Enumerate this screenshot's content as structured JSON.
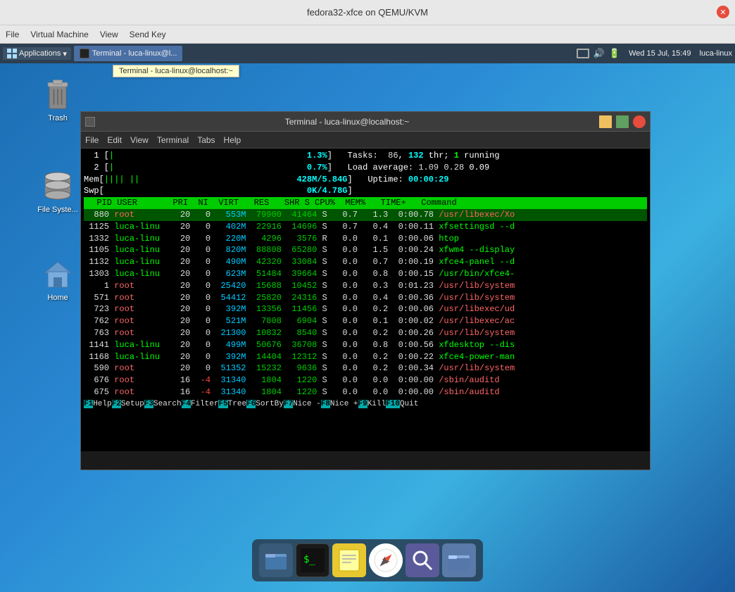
{
  "qemu": {
    "title": "fedora32-xfce on QEMU/KVM",
    "menu": {
      "file": "File",
      "virtual_machine": "Virtual Machine",
      "view": "View",
      "send_key": "Send Key"
    }
  },
  "xfce": {
    "applications": "Applications",
    "task_terminal": "Terminal - luca-linux@l...",
    "clock": "Wed 15 Jul, 15:49",
    "user": "luca-linux"
  },
  "tooltip": "Terminal - luca-linux@localhost:~",
  "desktop_icons": {
    "trash": "Trash",
    "filesystem": "File Syste...",
    "home": "Home"
  },
  "terminal": {
    "title": "Terminal - luca-linux@localhost:~",
    "menu": {
      "file": "File",
      "edit": "Edit",
      "view": "View",
      "terminal": "Terminal",
      "tabs": "Tabs",
      "help": "Help"
    }
  },
  "htop": {
    "cpu1_label": "1",
    "cpu1_bar": "[|  ",
    "cpu1_pct": "1.3%",
    "cpu2_label": "2",
    "cpu2_bar": "[| ",
    "cpu2_pct": "0.7%",
    "mem_label": "Mem",
    "mem_bar": "[|||| ||",
    "mem_val": "428M/5.84G",
    "swap_label": "Swp",
    "swap_bar": "[",
    "swap_val": "0K/4.78G",
    "tasks_label": "Tasks:",
    "tasks_count": "86",
    "tasks_thr": "132",
    "tasks_thr_label": "thr;",
    "tasks_running": "1",
    "tasks_running_label": "running",
    "load_label": "Load average:",
    "load1": "1.09",
    "load5": "0.28",
    "load15": "0.09",
    "uptime_label": "Uptime:",
    "uptime_val": "00:00:29",
    "columns": "  PID USER       PRI  NI  VIRT   RES   SHR S CPU%  MEM%   TIME+   Command",
    "processes": [
      {
        "pid": "880",
        "user": "root",
        "pri": "20",
        "ni": "0",
        "virt": "553M",
        "res": "79900",
        "shr": "41464",
        "s": "S",
        "cpu": "0.7",
        "mem": "1.3",
        "time": "0:00.78",
        "cmd": "/usr/libexec/Xo",
        "selected": true
      },
      {
        "pid": "1125",
        "user": "luca-linu",
        "pri": "20",
        "ni": "0",
        "virt": "402M",
        "res": "22916",
        "shr": "14696",
        "s": "S",
        "cpu": "0.7",
        "mem": "0.4",
        "time": "0:00.11",
        "cmd": "xfsettingsd --d",
        "selected": false
      },
      {
        "pid": "1332",
        "user": "luca-linu",
        "pri": "20",
        "ni": "0",
        "virt": "220M",
        "res": "4296",
        "shr": "3576",
        "s": "R",
        "cpu": "0.0",
        "mem": "0.1",
        "time": "0:00.06",
        "cmd": "htop",
        "selected": false
      },
      {
        "pid": "1105",
        "user": "luca-linu",
        "pri": "20",
        "ni": "0",
        "virt": "820M",
        "res": "88808",
        "shr": "65280",
        "s": "S",
        "cpu": "0.0",
        "mem": "1.5",
        "time": "0:00.24",
        "cmd": "xfwm4 --display",
        "selected": false
      },
      {
        "pid": "1132",
        "user": "luca-linu",
        "pri": "20",
        "ni": "0",
        "virt": "490M",
        "res": "42320",
        "shr": "33084",
        "s": "S",
        "cpu": "0.0",
        "mem": "0.7",
        "time": "0:00.19",
        "cmd": "xfce4-panel --d",
        "selected": false
      },
      {
        "pid": "1303",
        "user": "luca-linu",
        "pri": "20",
        "ni": "0",
        "virt": "623M",
        "res": "51484",
        "shr": "39664",
        "s": "S",
        "cpu": "0.0",
        "mem": "0.8",
        "time": "0:00.15",
        "cmd": "/usr/bin/xfce4-",
        "selected": false
      },
      {
        "pid": "1",
        "user": "root",
        "pri": "20",
        "ni": "0",
        "virt": "25420",
        "res": "15688",
        "shr": "10452",
        "s": "S",
        "cpu": "0.0",
        "mem": "0.3",
        "time": "0:01.23",
        "cmd": "/usr/lib/system",
        "selected": false
      },
      {
        "pid": "571",
        "user": "root",
        "pri": "20",
        "ni": "0",
        "virt": "54412",
        "res": "25820",
        "shr": "24316",
        "s": "S",
        "cpu": "0.0",
        "mem": "0.4",
        "time": "0:00.36",
        "cmd": "/usr/lib/system",
        "selected": false
      },
      {
        "pid": "723",
        "user": "root",
        "pri": "20",
        "ni": "0",
        "virt": "392M",
        "res": "13356",
        "shr": "11456",
        "s": "S",
        "cpu": "0.0",
        "mem": "0.2",
        "time": "0:00.06",
        "cmd": "/usr/libexec/ud",
        "selected": false
      },
      {
        "pid": "762",
        "user": "root",
        "pri": "20",
        "ni": "0",
        "virt": "521M",
        "res": "7808",
        "shr": "6904",
        "s": "S",
        "cpu": "0.0",
        "mem": "0.1",
        "time": "0:00.02",
        "cmd": "/usr/libexec/ac",
        "selected": false
      },
      {
        "pid": "763",
        "user": "root",
        "pri": "20",
        "ni": "0",
        "virt": "21300",
        "res": "10832",
        "shr": "8540",
        "s": "S",
        "cpu": "0.0",
        "mem": "0.2",
        "time": "0:00.26",
        "cmd": "/usr/lib/system",
        "selected": false
      },
      {
        "pid": "1141",
        "user": "luca-linu",
        "pri": "20",
        "ni": "0",
        "virt": "499M",
        "res": "50676",
        "shr": "36708",
        "s": "S",
        "cpu": "0.0",
        "mem": "0.8",
        "time": "0:00.56",
        "cmd": "xfdesktop --dis",
        "selected": false
      },
      {
        "pid": "1168",
        "user": "luca-linu",
        "pri": "20",
        "ni": "0",
        "virt": "392M",
        "res": "14404",
        "shr": "12312",
        "s": "S",
        "cpu": "0.0",
        "mem": "0.2",
        "time": "0:00.22",
        "cmd": "xfce4-power-man",
        "selected": false
      },
      {
        "pid": "590",
        "user": "root",
        "pri": "20",
        "ni": "0",
        "virt": "51352",
        "res": "15232",
        "shr": "9636",
        "s": "S",
        "cpu": "0.0",
        "mem": "0.2",
        "time": "0:00.34",
        "cmd": "/usr/lib/system",
        "selected": false
      },
      {
        "pid": "676",
        "user": "root",
        "pri": "16",
        "ni": "-4",
        "virt": "31340",
        "res": "1804",
        "shr": "1220",
        "s": "S",
        "cpu": "0.0",
        "mem": "0.0",
        "time": "0:00.00",
        "cmd": "/sbin/auditd",
        "selected": false
      },
      {
        "pid": "675",
        "user": "root",
        "pri": "16",
        "ni": "-4",
        "virt": "31340",
        "res": "1804",
        "shr": "1220",
        "s": "S",
        "cpu": "0.0",
        "mem": "0.0",
        "time": "0:00.00",
        "cmd": "/sbin/auditd",
        "selected": false
      }
    ],
    "footer": [
      {
        "key": "F1",
        "label": "Help"
      },
      {
        "key": "F2",
        "label": "Setup"
      },
      {
        "key": "F3",
        "label": "Search"
      },
      {
        "key": "F4",
        "label": "Filter"
      },
      {
        "key": "F5",
        "label": "Tree"
      },
      {
        "key": "F6",
        "label": "SortBy"
      },
      {
        "key": "F7",
        "label": "Nice -"
      },
      {
        "key": "F8",
        "label": "Nice +"
      },
      {
        "key": "F9",
        "label": "Kill"
      },
      {
        "key": "F10",
        "label": "Quit"
      }
    ]
  },
  "dock": {
    "items": [
      {
        "name": "file-manager-dock",
        "icon": "🖥",
        "bg": "#3a5a7a"
      },
      {
        "name": "terminal-dock",
        "icon": "⬛",
        "bg": "#222"
      },
      {
        "name": "notes-dock",
        "icon": "📋",
        "bg": "#e8c830"
      },
      {
        "name": "safari-dock",
        "icon": "🧭",
        "bg": "#3a8a3a"
      },
      {
        "name": "search-dock",
        "icon": "🔍",
        "bg": "#5a5a8a"
      },
      {
        "name": "files-dock",
        "icon": "📁",
        "bg": "#5a7aaa"
      }
    ]
  }
}
